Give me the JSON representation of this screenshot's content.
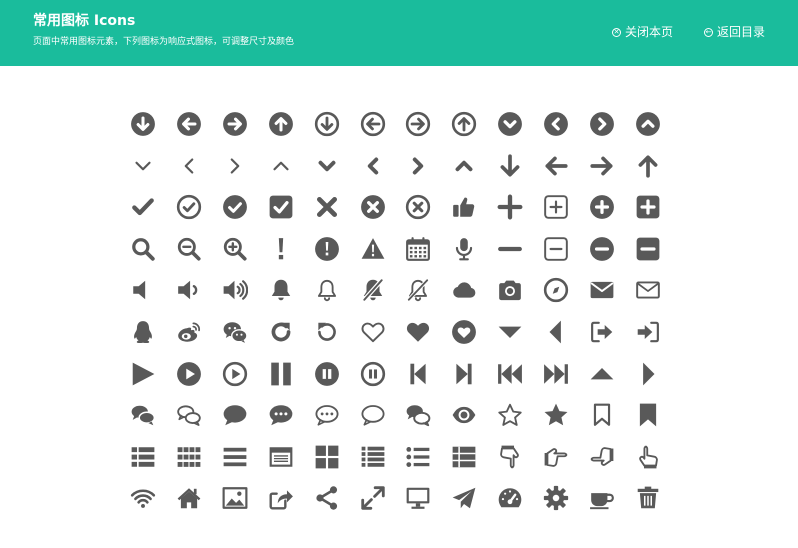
{
  "header": {
    "title": "常用图标 Icons",
    "subtitle": "页面中常用图标元素，下列图标为响应式图标，可调整尺寸及颜色",
    "close_label": "关闭本页",
    "back_label": "返回目录",
    "bg_color": "#1abc9c"
  },
  "icon_color": "#595959",
  "icons": [
    [
      "arrow-down-circle",
      "arrow-left-circle",
      "arrow-right-circle",
      "arrow-up-circle",
      "arrow-down-circle-outline",
      "arrow-left-circle-outline",
      "arrow-right-circle-outline",
      "arrow-up-circle-outline",
      "chevron-down-circle",
      "chevron-left-circle",
      "chevron-right-circle",
      "chevron-up-circle"
    ],
    [
      "chevron-down",
      "chevron-left",
      "chevron-right",
      "chevron-up",
      "chevron-down-bold",
      "chevron-left-bold",
      "chevron-right-bold",
      "chevron-up-bold",
      "arrow-down",
      "arrow-left",
      "arrow-right",
      "arrow-up"
    ],
    [
      "check",
      "check-circle-outline",
      "check-circle",
      "check-square",
      "times",
      "times-circle",
      "times-circle-outline",
      "thumbs-up",
      "plus",
      "plus-square-outline",
      "plus-circle",
      "plus-square"
    ],
    [
      "search",
      "zoom-out",
      "zoom-in",
      "exclamation",
      "exclamation-circle",
      "exclamation-triangle",
      "calendar",
      "microphone",
      "minus",
      "minus-square-outline",
      "minus-circle",
      "minus-square"
    ],
    [
      "volume-off",
      "volume-down",
      "volume-up",
      "bell",
      "bell-outline",
      "bell-slash",
      "bell-slash-outline",
      "cloud",
      "camera",
      "compass",
      "envelope",
      "envelope-outline"
    ],
    [
      "qq",
      "weibo",
      "wechat",
      "redo",
      "undo",
      "heart-outline",
      "heart",
      "heart-circle",
      "caret-down",
      "caret-left",
      "sign-out",
      "sign-in"
    ],
    [
      "play",
      "play-circle",
      "play-circle-outline",
      "pause",
      "pause-circle",
      "pause-circle-outline",
      "step-backward",
      "step-forward",
      "fast-backward",
      "fast-forward",
      "caret-up",
      "caret-right"
    ],
    [
      "comments",
      "comments-outline",
      "comment",
      "comment-dots",
      "comment-dots-outline",
      "comment-outline",
      "comments-alt",
      "eye",
      "star-outline",
      "star",
      "bookmark-outline",
      "bookmark"
    ],
    [
      "list",
      "grid-list",
      "bars",
      "browser",
      "th-large",
      "list-alt",
      "list-ul",
      "th-list",
      "hand-down",
      "hand-right",
      "hand-left",
      "hand-up"
    ],
    [
      "wifi",
      "home",
      "image",
      "share-square",
      "share-alt",
      "expand",
      "desktop",
      "paper-plane",
      "dashboard",
      "cog",
      "coffee",
      "trash"
    ]
  ]
}
